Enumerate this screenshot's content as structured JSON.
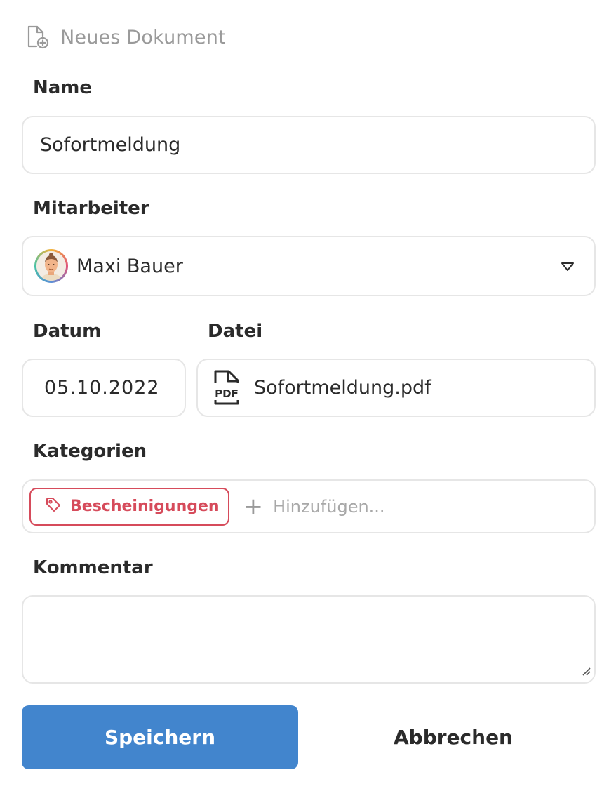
{
  "header": {
    "title": "Neues Dokument",
    "icon": "new-document-icon"
  },
  "name": {
    "label": "Name",
    "value": "Sofortmeldung"
  },
  "employee": {
    "label": "Mitarbeiter",
    "value": "Maxi Bauer",
    "avatar_icon": "user-avatar",
    "caret_icon": "chevron-down-icon"
  },
  "date": {
    "label": "Datum",
    "value": "05.10.2022"
  },
  "file": {
    "label": "Datei",
    "value": "Sofortmeldung.pdf",
    "icon": "pdf-file-icon"
  },
  "categories": {
    "label": "Kategorien",
    "tags": [
      {
        "label": "Bescheinigungen",
        "color": "#d64b5b",
        "icon": "tag-icon"
      }
    ],
    "add_icon": "plus-icon",
    "add_placeholder": "Hinzufügen..."
  },
  "comment": {
    "label": "Kommentar",
    "value": ""
  },
  "actions": {
    "save_label": "Speichern",
    "cancel_label": "Abbrechen",
    "primary_color": "#4285cd"
  }
}
